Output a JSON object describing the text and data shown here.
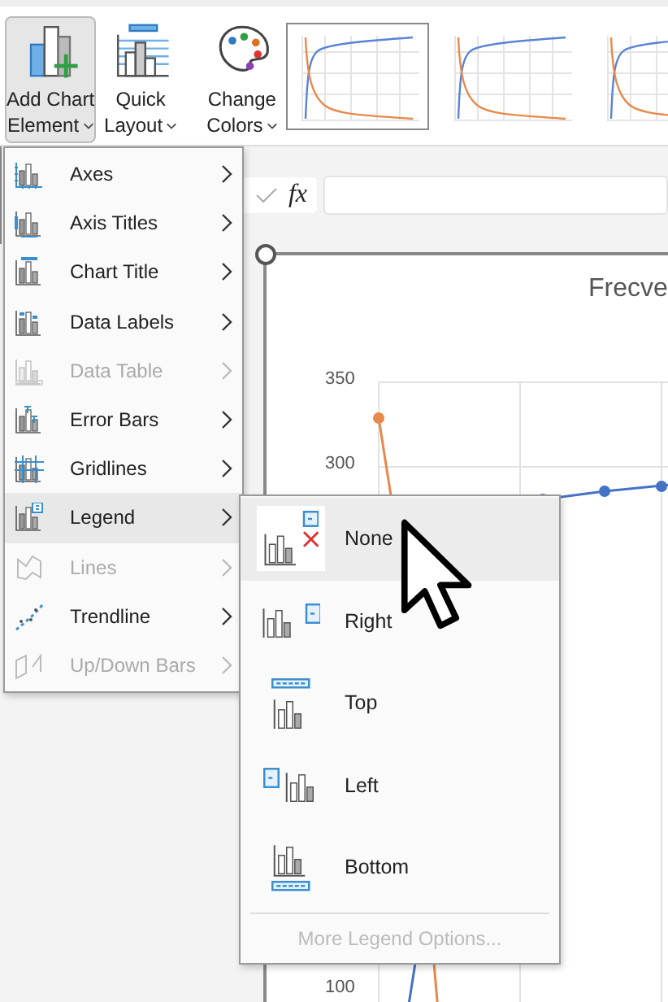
{
  "ribbon": {
    "buttons": [
      {
        "kind": "add-element",
        "label": [
          "Add Chart",
          "Element"
        ],
        "selected": true
      },
      {
        "kind": "quick-layout",
        "label": [
          "Quick",
          "Layout"
        ],
        "selected": false
      },
      {
        "kind": "change-colors",
        "label": [
          "Change",
          "Colors"
        ],
        "selected": false
      }
    ],
    "chart_styles": [
      {
        "selected": true
      },
      {
        "selected": false
      },
      {
        "selected": false
      }
    ]
  },
  "formula_bar": {
    "function_label": "fx"
  },
  "chart": {
    "title": "Frecve",
    "y_labels": [
      "350",
      "300",
      "100"
    ]
  },
  "menu": {
    "items": [
      {
        "kind": "axes",
        "label": "Axes",
        "disabled": false,
        "selected": false
      },
      {
        "kind": "axis-titles",
        "label": "Axis Titles",
        "disabled": false,
        "selected": false
      },
      {
        "kind": "chart-title",
        "label": "Chart Title",
        "disabled": false,
        "selected": false
      },
      {
        "kind": "data-labels",
        "label": "Data Labels",
        "disabled": false,
        "selected": false
      },
      {
        "kind": "data-table",
        "label": "Data Table",
        "disabled": true,
        "selected": false
      },
      {
        "kind": "error-bars",
        "label": "Error Bars",
        "disabled": false,
        "selected": false
      },
      {
        "kind": "gridlines",
        "label": "Gridlines",
        "disabled": false,
        "selected": false
      },
      {
        "kind": "legend",
        "label": "Legend",
        "disabled": false,
        "selected": true
      },
      {
        "kind": "lines",
        "label": "Lines",
        "disabled": true,
        "selected": false
      },
      {
        "kind": "trendline",
        "label": "Trendline",
        "disabled": false,
        "selected": false
      },
      {
        "kind": "up-down-bars",
        "label": "Up/Down Bars",
        "disabled": true,
        "selected": false
      }
    ]
  },
  "submenu": {
    "items": [
      {
        "kind": "none",
        "label": "None",
        "selected": true
      },
      {
        "kind": "right",
        "label": "Right",
        "selected": false
      },
      {
        "kind": "top",
        "label": "Top",
        "selected": false
      },
      {
        "kind": "left",
        "label": "Left",
        "selected": false
      },
      {
        "kind": "bottom",
        "label": "Bottom",
        "selected": false
      }
    ],
    "footer": {
      "label": "More Legend Options...",
      "disabled": true
    }
  }
}
